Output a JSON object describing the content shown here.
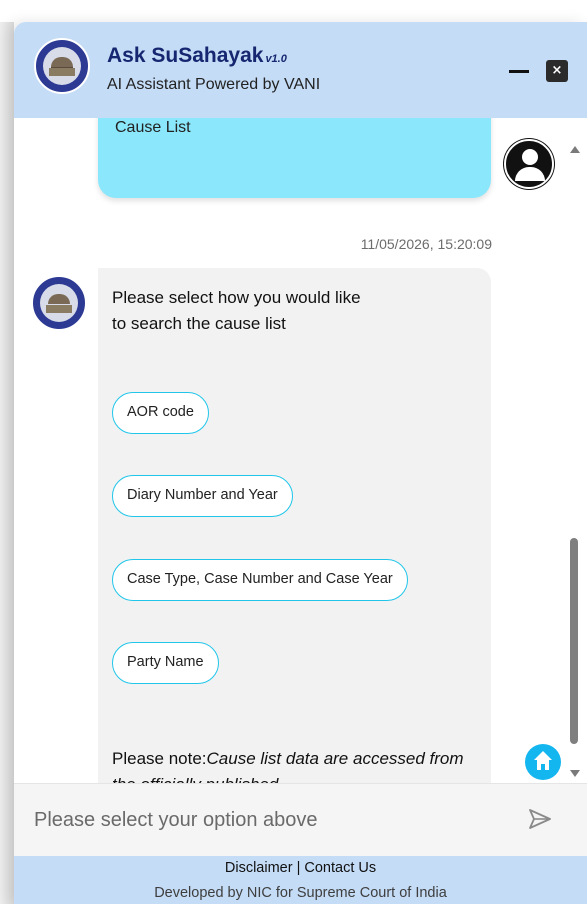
{
  "header": {
    "title": "Ask SuSahayak",
    "version": "v1.0",
    "subtitle": "AI Assistant Powered by VANI",
    "close_label": "×"
  },
  "chat": {
    "user_message": "Cause List",
    "timestamp": "11/05/2026, 15:20:09",
    "bot_prompt": "Please select how you would like to search the cause list",
    "options": [
      "AOR code",
      "Diary Number and Year",
      "Case Type, Case Number and Case Year",
      "Party Name"
    ],
    "note_label": "Please note:",
    "note_text": "Cause list data are accessed from the officially published"
  },
  "input": {
    "placeholder": "Please select your option above"
  },
  "footer": {
    "disclaimer": "Disclaimer",
    "separator": " | ",
    "contact": "Contact Us",
    "credit": "Developed by NIC for Supreme Court of India"
  },
  "colors": {
    "header_bg": "#c5dcf6",
    "user_bubble": "#8be7fb",
    "option_border": "#20c6ea",
    "home_button": "#14b6ef"
  }
}
